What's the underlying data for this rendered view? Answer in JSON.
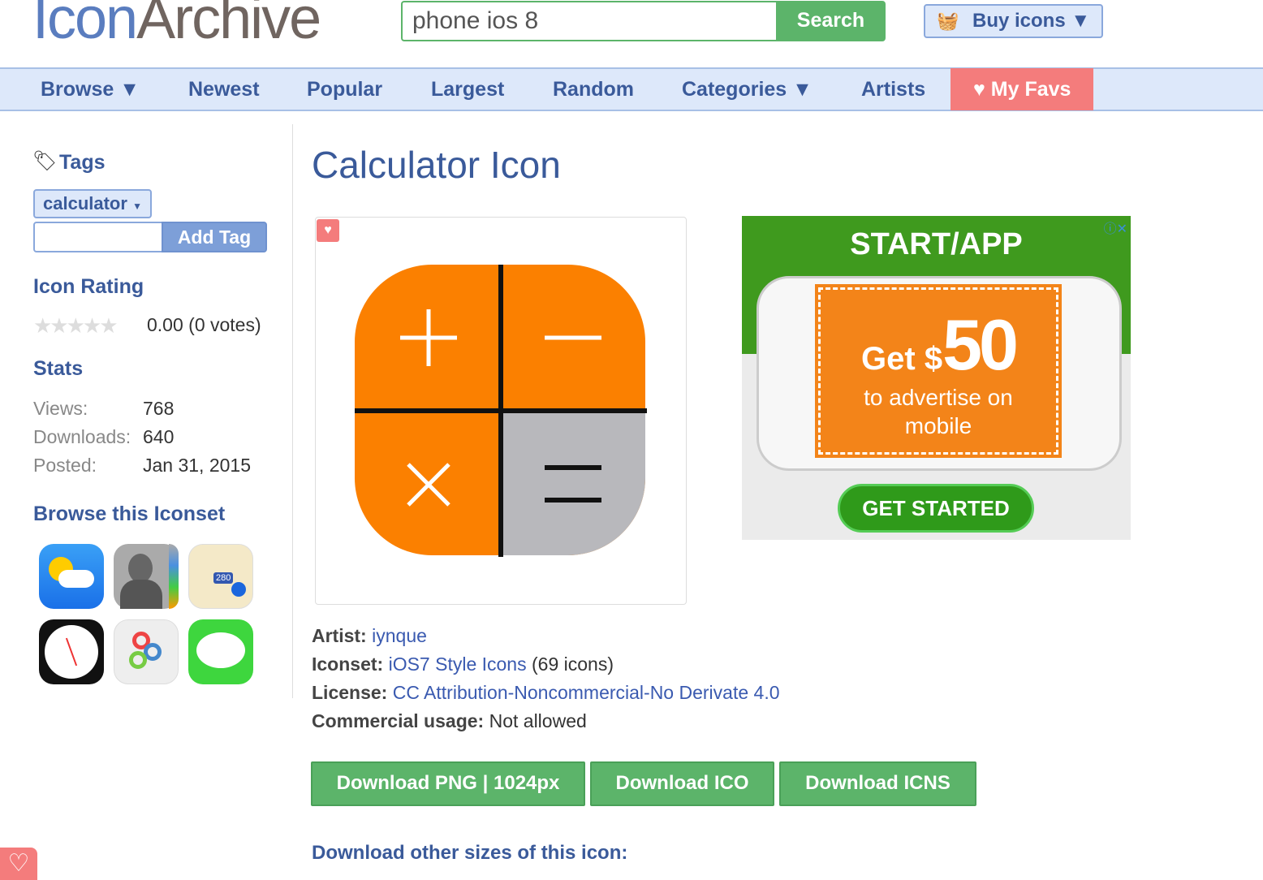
{
  "header": {
    "logo_part1": "Icon",
    "logo_part2": "Archive",
    "search_value": "phone ios 8",
    "search_button": "Search",
    "buy_button": "Buy icons ▼"
  },
  "nav": {
    "items": [
      "Browse ▼",
      "Newest",
      "Popular",
      "Largest",
      "Random",
      "Categories ▼",
      "Artists"
    ],
    "favs": "♥ My Favs"
  },
  "sidebar": {
    "tags_heading": "Tags",
    "tag": "calculator",
    "add_tag": "Add Tag",
    "rating_heading": "Icon Rating",
    "rating_value": 0,
    "rating_text": "0.00 (0 votes)",
    "stats_heading": "Stats",
    "stats": [
      {
        "label": "Views:",
        "value": "768"
      },
      {
        "label": "Downloads:",
        "value": "640"
      },
      {
        "label": "Posted:",
        "value": "Jan 31, 2015"
      }
    ],
    "browse_heading": "Browse this Iconset",
    "iconset_thumbs": [
      "weather-icon",
      "contacts-icon",
      "maps-icon",
      "clock-icon",
      "game-center-icon",
      "messages-icon"
    ]
  },
  "main": {
    "title": "Calculator Icon",
    "ad": {
      "brand": "START/APP",
      "line1": "Get $",
      "amount": "50",
      "line2": "to advertise on",
      "line3": "mobile",
      "cta": "GET STARTED"
    },
    "details": {
      "artist_label": "Artist:",
      "artist": "iynque",
      "iconset_label": "Iconset:",
      "iconset": "iOS7 Style Icons",
      "iconset_count": "(69 icons)",
      "license_label": "License:",
      "license": "CC Attribution-Noncommercial-No Derivate 4.0",
      "commercial_label": "Commercial usage:",
      "commercial": "Not allowed"
    },
    "downloads": [
      "Download PNG | 1024px",
      "Download ICO",
      "Download ICNS"
    ],
    "other_sizes": "Download other sizes of this icon:"
  },
  "colors": {
    "brand_blue": "#3a5a9a",
    "green": "#5cb46a",
    "fav": "#f47c7c",
    "calc_orange": "#fb8000"
  }
}
